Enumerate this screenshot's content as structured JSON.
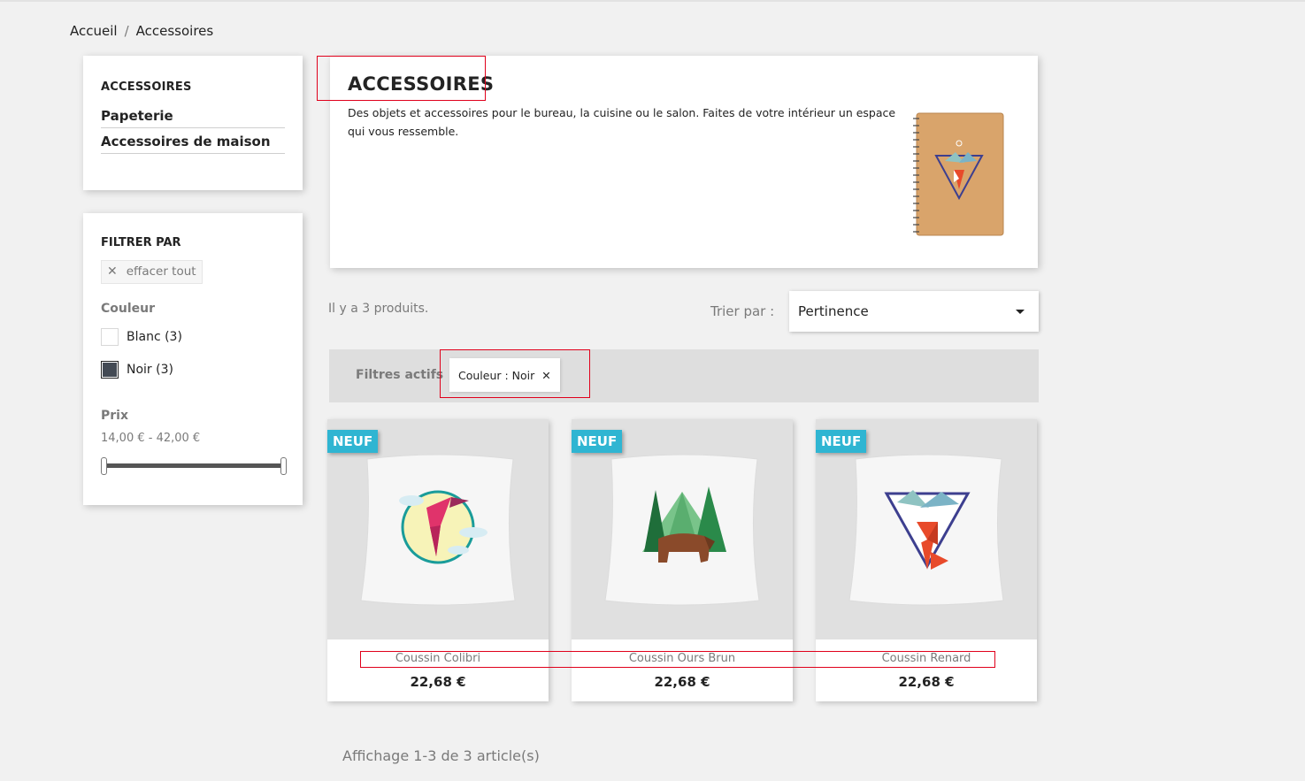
{
  "breadcrumb": {
    "home": "Accueil",
    "separator": "/",
    "current": "Accessoires"
  },
  "sidebar": {
    "title": "ACCESSOIRES",
    "items": [
      {
        "label": "Papeterie"
      },
      {
        "label": "Accessoires de maison"
      }
    ]
  },
  "filters": {
    "title": "FILTRER PAR",
    "clear_all": "effacer tout",
    "color": {
      "title": "Couleur",
      "options": [
        {
          "label": "Blanc (3)",
          "swatch": "#ffffff"
        },
        {
          "label": "Noir (3)",
          "swatch": "#434a54"
        }
      ]
    },
    "price": {
      "title": "Prix",
      "range": "14,00 € - 42,00 €"
    }
  },
  "category": {
    "title": "ACCESSOIRES",
    "description": "Des objets et accessoires pour le bureau, la cuisine ou le salon. Faites de votre intérieur un espace qui vous ressemble."
  },
  "listing": {
    "count": "Il y a 3 produits.",
    "sort_label": "Trier par :",
    "sort_value": "Pertinence",
    "active_filters_label": "Filtres actifs",
    "active_filter_chip": "Couleur : Noir",
    "pagination": "Affichage 1-3 de 3 article(s)"
  },
  "products": [
    {
      "badge": "NEUF",
      "name": "Coussin Colibri",
      "price": "22,68 €"
    },
    {
      "badge": "NEUF",
      "name": "Coussin Ours Brun",
      "price": "22,68 €"
    },
    {
      "badge": "NEUF",
      "name": "Coussin Renard",
      "price": "22,68 €"
    }
  ],
  "colors": {
    "accent": "#2fb5d2",
    "highlight": "#e0001b"
  }
}
